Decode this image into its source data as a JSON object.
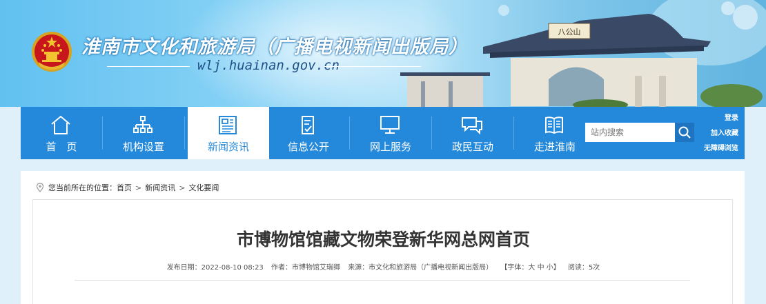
{
  "header": {
    "site_title": "淮南市文化和旅游局（广播电视新闻出版局）",
    "domain": "wlj.huainan.gov.cn",
    "plaque_text": "八公山"
  },
  "nav": {
    "items": [
      {
        "label": "首　页",
        "icon": "home-icon"
      },
      {
        "label": "机构设置",
        "icon": "org-chart-icon"
      },
      {
        "label": "新闻资讯",
        "icon": "news-icon",
        "active": true
      },
      {
        "label": "信息公开",
        "icon": "document-check-icon"
      },
      {
        "label": "网上服务",
        "icon": "monitor-icon"
      },
      {
        "label": "政民互动",
        "icon": "chat-icon"
      },
      {
        "label": "走进淮南",
        "icon": "book-icon"
      }
    ],
    "search_placeholder": "站内搜索",
    "links": [
      "登录",
      "加入收藏",
      "无障碍浏览"
    ]
  },
  "breadcrumb": {
    "prefix": "您当前所在的位置：",
    "items": [
      "首页",
      "新闻资讯",
      "文化要闻"
    ]
  },
  "article": {
    "title": "市博物馆馆藏文物荣登新华网总网首页",
    "meta": {
      "published": "发布日期：2022-08-10 08:23",
      "author": "作者：市博物馆艾瑞卿",
      "source": "来源：市文化和旅游局（广播电视新闻出版局）",
      "font_size_prefix": "【字体：",
      "font_sizes": [
        "大",
        "中",
        "小"
      ],
      "font_size_suffix": "】",
      "views": "阅读：5次"
    }
  },
  "colors": {
    "nav_bg": "#2489da",
    "active_text": "#2489da",
    "page_bg": "#dff0fb"
  }
}
